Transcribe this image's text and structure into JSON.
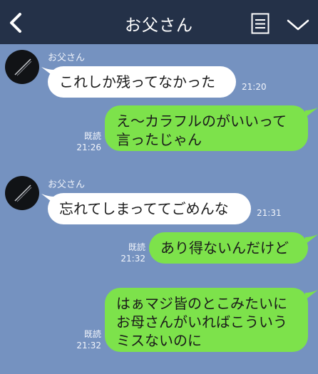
{
  "header": {
    "title": "お父さん",
    "icons": [
      "back-arrow-icon",
      "note-icon",
      "chevron-down-icon"
    ]
  },
  "messages": [
    {
      "side": "left",
      "sender": "お父さん",
      "text": "これしか残ってなかった",
      "time": "21:20"
    },
    {
      "side": "right",
      "text": "え〜カラフルのがいいって\n言ったじゃん",
      "read": "既読",
      "time": "21:26"
    },
    {
      "side": "left",
      "sender": "お父さん",
      "text": "忘れてしまっててごめんな",
      "time": "21:31"
    },
    {
      "side": "right",
      "text": "あり得ないんだけど",
      "read": "既読",
      "time": "21:32"
    },
    {
      "side": "right",
      "text": "はぁマジ皆のとこみたいに\nお母さんがいればこういう\nミスないのに",
      "read": "既読",
      "time": "21:32"
    }
  ],
  "colors": {
    "background": "#7592c0",
    "header": "#243148",
    "green_bubble": "#7de24b",
    "white_bubble": "#ffffff"
  }
}
